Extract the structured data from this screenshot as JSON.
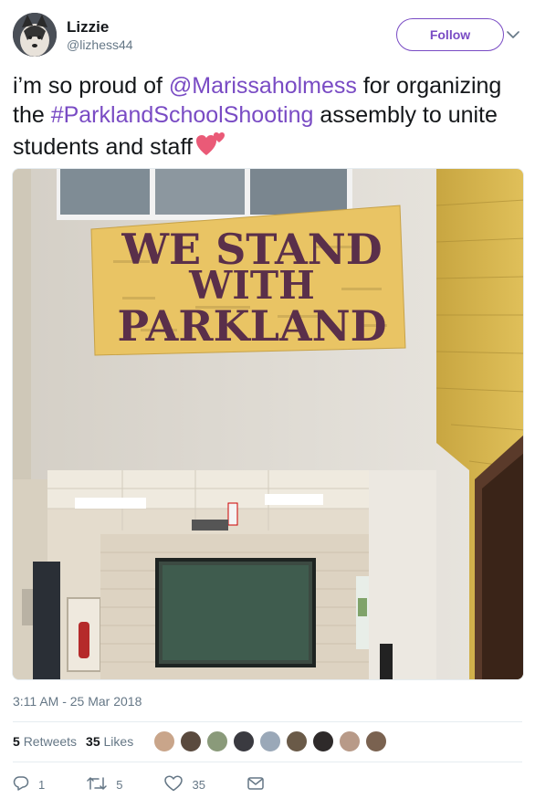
{
  "user": {
    "display_name": "Lizzie",
    "handle": "@lizhess44"
  },
  "follow_label": "Follow",
  "tweet": {
    "text_1": "i’m so proud of ",
    "mention": "@Marissaholmess",
    "text_2": " for organizing the ",
    "hashtag": "#ParklandSchoolShooting",
    "text_3": " assembly to unite students and staff",
    "emoji_icon": "two-hearts-icon"
  },
  "photo": {
    "banner_line_1": "WE STAND",
    "banner_line_2": "WITH",
    "banner_line_3": "PARKLAND"
  },
  "timestamp": "3:11 AM - 25 Mar 2018",
  "stats": {
    "retweets_count": "5",
    "retweets_label": "Retweets",
    "likes_count": "35",
    "likes_label": "Likes"
  },
  "actions": {
    "reply_count": "1",
    "retweet_count": "5",
    "like_count": "35"
  },
  "colors": {
    "accent": "#794bc4",
    "secondary_text": "#657786",
    "border": "#e6ecf0"
  }
}
